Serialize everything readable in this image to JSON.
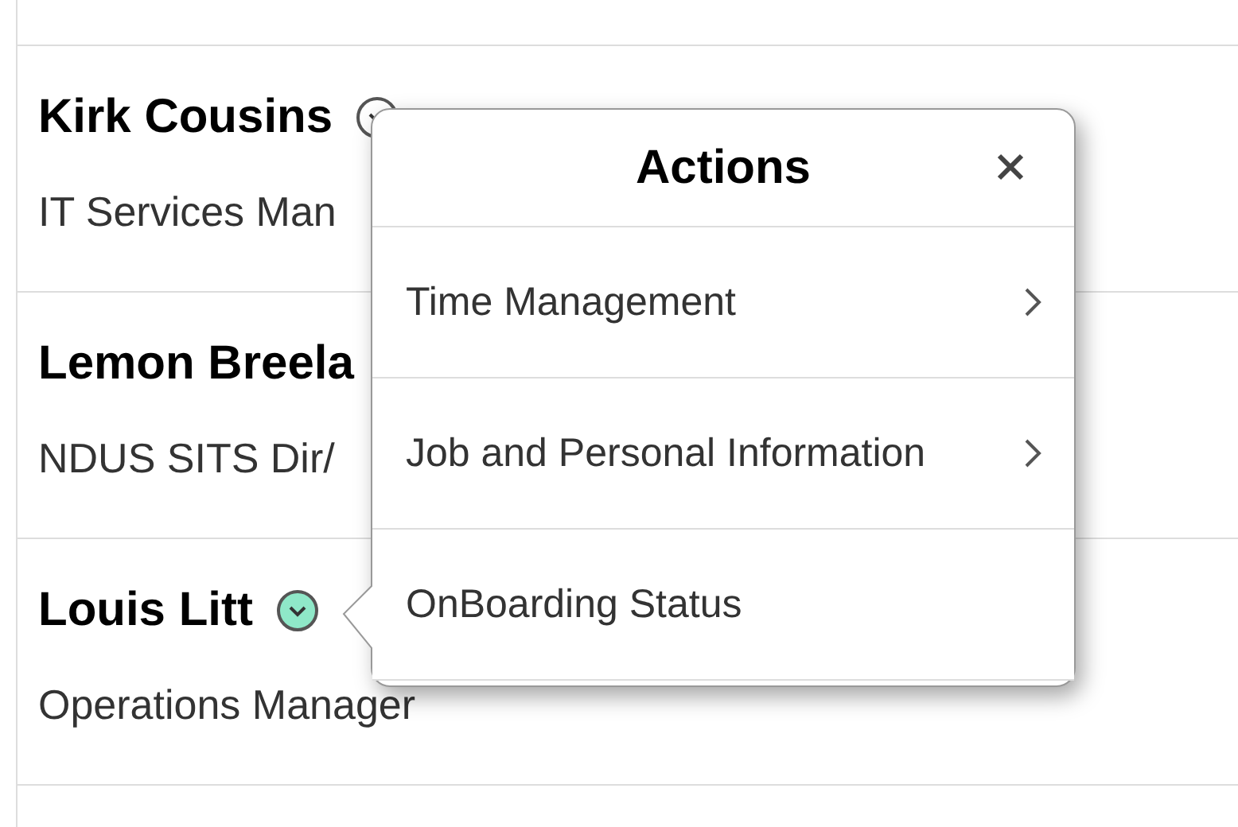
{
  "people": [
    {
      "name": "Kirk Cousins",
      "title": "IT Services Man",
      "menu_button": {
        "active": false
      }
    },
    {
      "name": "Lemon Breela",
      "title": "NDUS SITS Dir/"
    },
    {
      "name": "Louis Litt",
      "title": "Operations Manager",
      "menu_button": {
        "active": true
      }
    }
  ],
  "actions_popup": {
    "title": "Actions",
    "items": [
      {
        "label": "Time Management",
        "has_submenu": true
      },
      {
        "label": "Job and Personal Information",
        "has_submenu": true
      },
      {
        "label": "OnBoarding Status",
        "has_submenu": false
      }
    ]
  }
}
